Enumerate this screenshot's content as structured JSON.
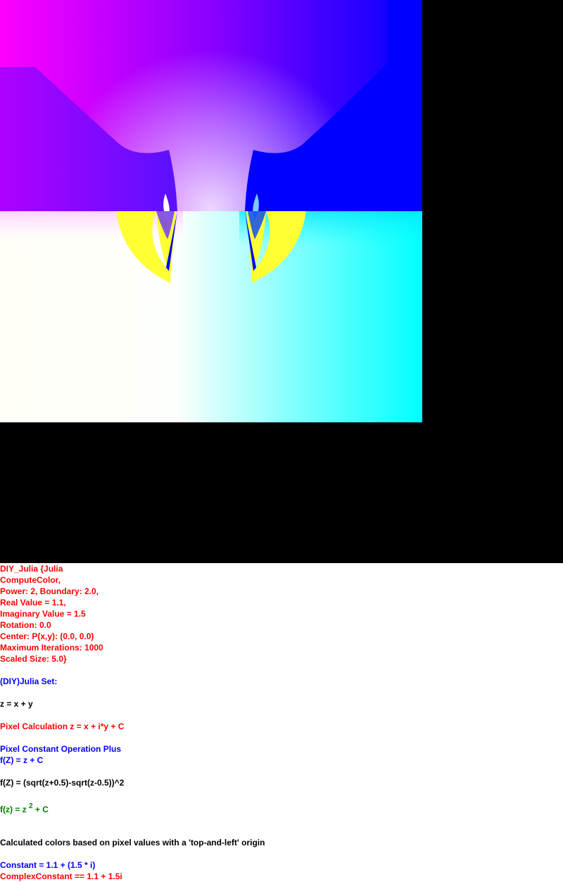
{
  "colors": {
    "red": "#ff0000",
    "blue": "#0000ff",
    "black": "#000000",
    "green": "#008000",
    "magenta": "#ff00ff",
    "cyan": "#00ffff",
    "yellow": "#ffff33"
  },
  "image": {
    "icon": "julia-set-fractal-render"
  },
  "params": [
    "DIY_Julia {Julia",
    "ComputeColor,",
    "Power: 2, Boundary: 2.0,",
    "Real Value = 1.1,",
    "Imaginary Value = 1.5",
    "Rotation: 0.0",
    "Center: P(x,y): (0.0, 0.0)",
    "Maximum Iterations: 1000",
    "Scaled Size: 5.0}"
  ],
  "title": "(DIY)Julia Set:",
  "z_def": "z = x + y",
  "pixel_calc": "Pixel Calculation z = x + i*y + C",
  "pixel_op": "Pixel Constant Operation Plus",
  "f_plus": "f(Z) = z + C",
  "f_sqrt": "f(Z) = (sqrt(z+0.5)-sqrt(z-0.5))^2",
  "f_power": {
    "prefix": "f(z) = z ",
    "exponent": "2",
    "suffix": " + C"
  },
  "origin_note": "Calculated colors based on pixel values with a 'top-and-left' origin",
  "constant": "Constant = 1.1 + (1.5 * i)",
  "complex_constant": "ComplexConstant == 1.1 + 1.5i"
}
